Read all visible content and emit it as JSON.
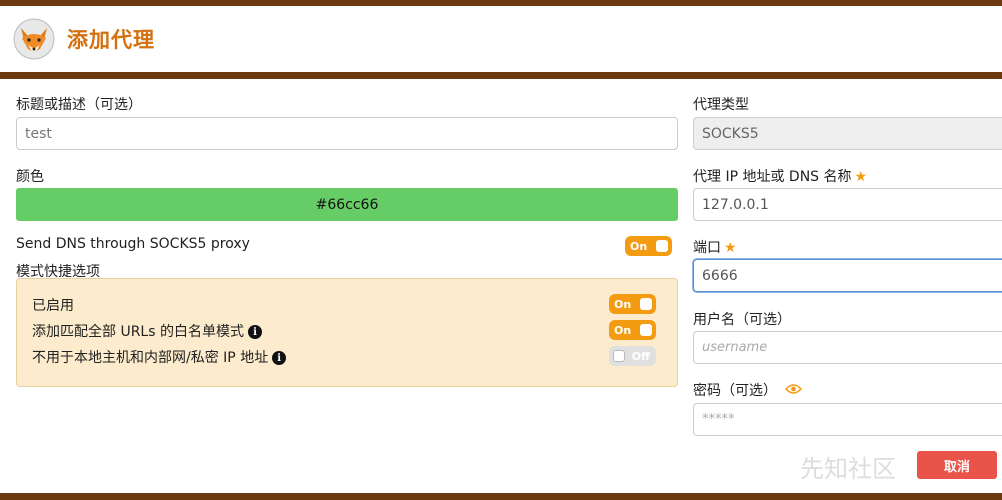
{
  "header": {
    "title": "添加代理",
    "logo_icon": "fox-logo-icon"
  },
  "left": {
    "title_label": "标题或描述（可选）",
    "title_value": "test",
    "color_label": "颜色",
    "color_value": "#66cc66",
    "dns_label": "Send DNS through SOCKS5 proxy",
    "dns_toggle": "On",
    "quick_label": "模式快捷选项",
    "quick": {
      "enabled_label": "已启用",
      "enabled_toggle": "On",
      "whitelist_label": "添加匹配全部 URLs 的白名单模式",
      "whitelist_toggle": "On",
      "local_label": "不用于本地主机和内部网/私密 IP 地址",
      "local_toggle": "Off"
    }
  },
  "right": {
    "type_label": "代理类型",
    "type_value": "SOCKS5",
    "host_label": "代理 IP 地址或 DNS 名称",
    "host_value": "127.0.0.1",
    "port_label": "端口",
    "port_value": "6666",
    "user_label": "用户名（可选）",
    "user_placeholder": "username",
    "pass_label": "密码（可选）",
    "pass_placeholder": "*****",
    "cancel_label": "取消"
  },
  "watermark": "先知社区",
  "colors": {
    "accent": "#f39c12",
    "brand": "#d4700e",
    "cancel": "#e9534a",
    "swatch": "#66cc66"
  }
}
